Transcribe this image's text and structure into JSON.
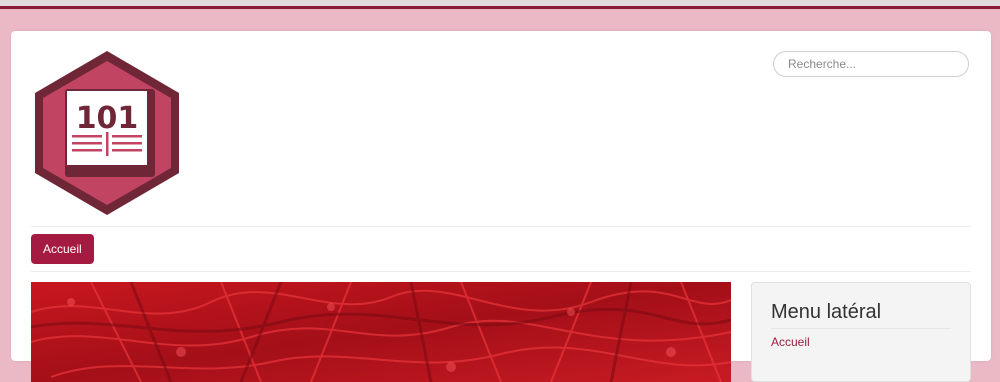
{
  "logo": {
    "text": "101"
  },
  "search": {
    "placeholder": "Recherche..."
  },
  "nav": {
    "items": [
      {
        "label": "Accueil"
      }
    ]
  },
  "sidebar": {
    "title": "Menu latéral",
    "items": [
      {
        "label": "Accueil"
      }
    ]
  },
  "colors": {
    "background": "#ebb8c5",
    "accent": "#a51a40",
    "top_bar": "#8a1d38"
  }
}
